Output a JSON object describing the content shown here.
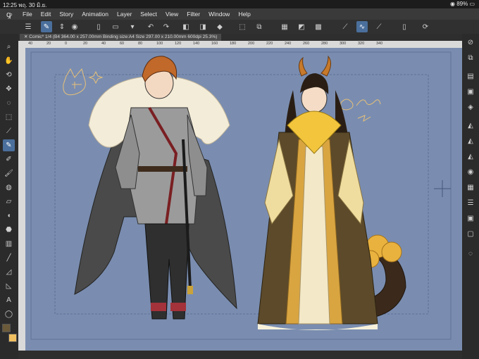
{
  "status_bar": {
    "time": "12:25",
    "date": "พฤ. 30 มิ.ย.",
    "battery": "89%"
  },
  "menu": {
    "items": [
      "File",
      "Edit",
      "Story",
      "Animation",
      "Layer",
      "Select",
      "View",
      "Filter",
      "Window",
      "Help"
    ]
  },
  "document_tab": {
    "title": "Comic* 1/4 (B4 364.00 x 257.00mm Binding size:A4 Size 297.00 x 210.00mm 600dpi 25.3%)"
  },
  "ruler": {
    "ticks": [
      "40",
      "20",
      "0",
      "20",
      "40",
      "60",
      "80",
      "100",
      "120",
      "140",
      "160",
      "180",
      "200",
      "220",
      "240",
      "260",
      "280",
      "300",
      "320",
      "340"
    ]
  },
  "colors": {
    "canvas": "#7a8db0",
    "ui_dark": "#2b2b2b",
    "active": "#4a6f9c",
    "main_color": "#6b5a3a",
    "sub_color": "#f0c060"
  },
  "icons": {
    "left": [
      "zoom-icon",
      "hand-icon",
      "rotate-icon",
      "move-icon",
      "lasso-icon",
      "eyedropper-icon",
      "pen-icon",
      "brush-icon",
      "airbrush-icon",
      "eraser-icon",
      "fill-icon",
      "blend-icon",
      "figure-icon",
      "text-icon",
      "balloon-icon"
    ],
    "right": [
      "navigator-icon",
      "subview-icon",
      "layers-icon",
      "layer-property-icon",
      "tool-property-icon",
      "color-wheel-icon",
      "color-set-icon",
      "history-icon",
      "search-icon",
      "settings-icon"
    ]
  }
}
